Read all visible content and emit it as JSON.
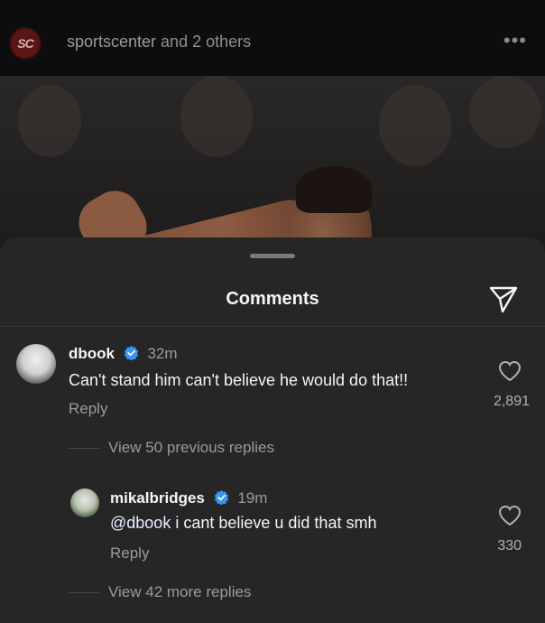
{
  "post": {
    "logo_text": "SC",
    "author": "sportscenter",
    "author_suffix": " and 2 others",
    "more_icon": "more-dots-icon"
  },
  "sheet": {
    "title": "Comments",
    "share_icon": "paper-plane-icon"
  },
  "comments": [
    {
      "username": "dbook",
      "verified": true,
      "time": "32m",
      "text": "Can't stand him can't believe he would do that!!",
      "reply_label": "Reply",
      "likes": "2,891"
    },
    {
      "username": "mikalbridges",
      "verified": true,
      "time": "19m",
      "mention": "@dbook",
      "text": " i cant believe u did that smh",
      "reply_label": "Reply",
      "likes": "330"
    }
  ],
  "view_previous": "View 50 previous replies",
  "view_more": "View 42 more replies",
  "colors": {
    "sheet_bg": "#262626",
    "verified_blue": "#3897f0"
  }
}
